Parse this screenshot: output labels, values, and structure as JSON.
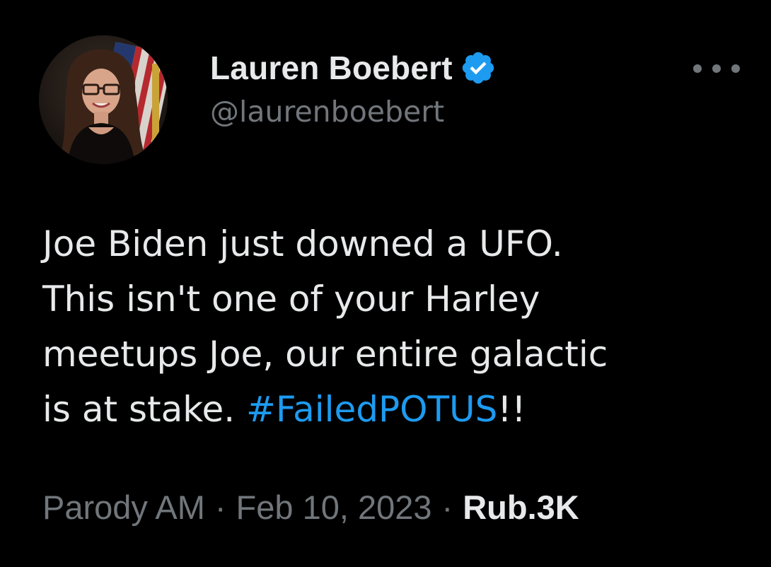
{
  "tweet": {
    "author": {
      "display_name": "Lauren Boebert",
      "handle": "@laurenboebert",
      "verified": true,
      "avatar_icon": "profile-photo"
    },
    "more_icon": "more-horizontal-icon",
    "text_lines": [
      "Joe Biden just downed a UFO.",
      "This isn't one of your Harley",
      "meetups Joe, our entire galactic",
      "is at stake. "
    ],
    "hashtag": "#FailedPOTUS",
    "text_suffix": "!!",
    "meta": {
      "source": "Parody AM",
      "separator": "·",
      "date": "Feb 10, 2023",
      "views": "Rub.3K"
    }
  },
  "colors": {
    "background": "#000000",
    "text": "#e7e9ea",
    "secondary": "#71767b",
    "accent": "#1d9bf0"
  }
}
